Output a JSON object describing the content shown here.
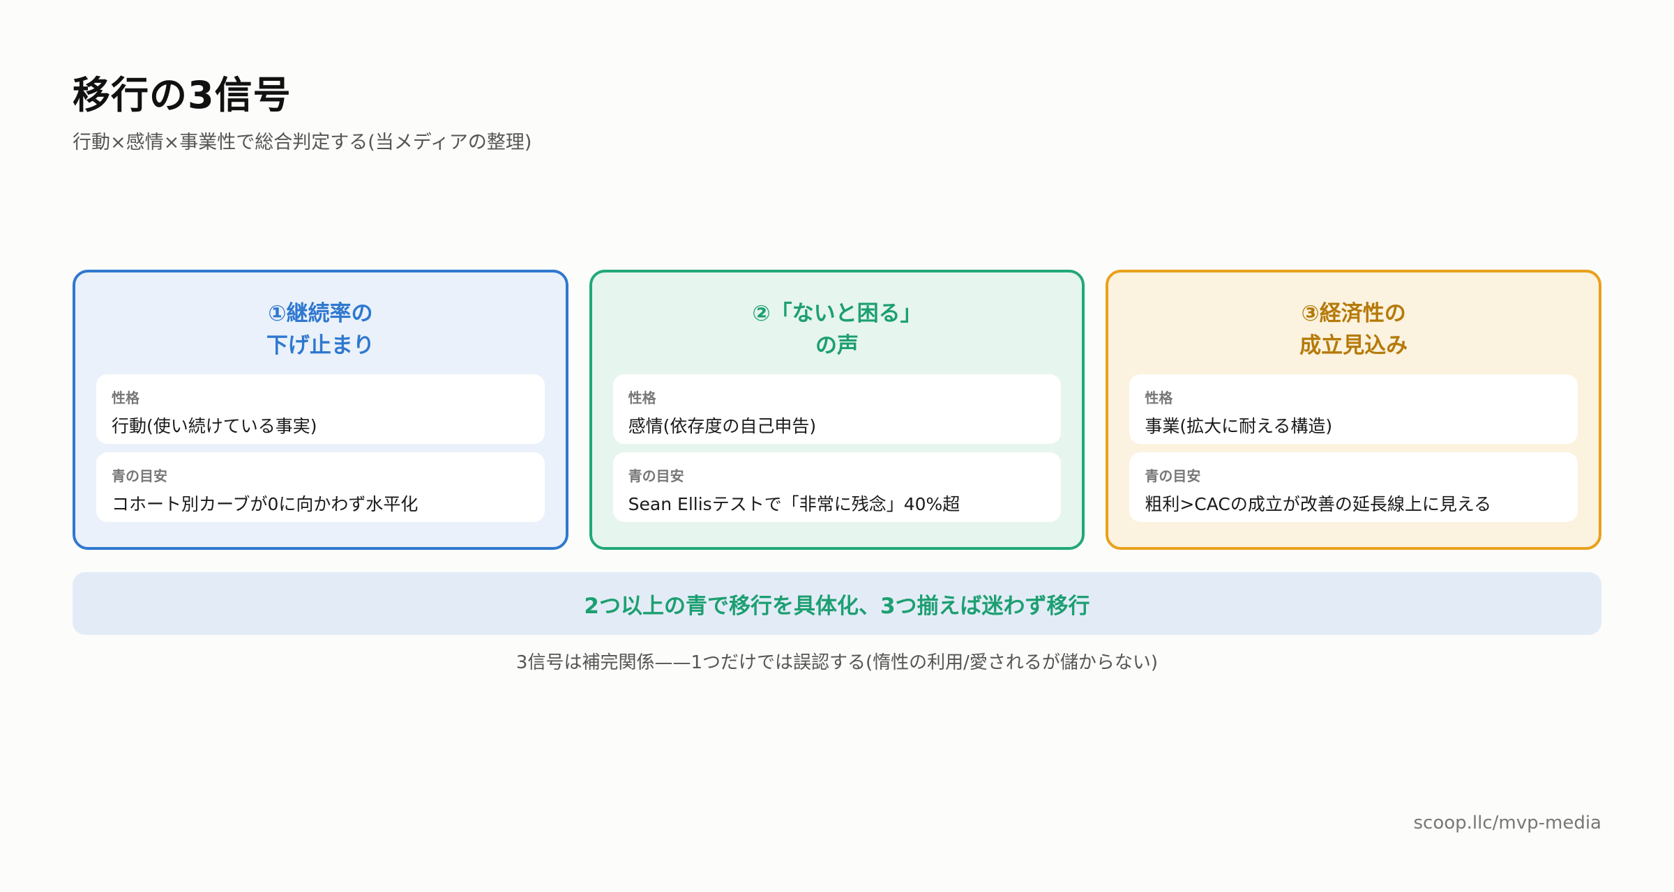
{
  "header": {
    "title": "移行の3信号",
    "subtitle": "行動×感情×事業性で総合判定する(当メディアの整理)"
  },
  "cards": [
    {
      "title_line1": "①継続率の",
      "title_line2": "下げ止まり",
      "nature_label": "性格",
      "nature_value": "行動(使い続けている事実)",
      "target_label": "青の目安",
      "target_value": "コホート別カーブが0に向かわず水平化",
      "accent": "#2f78cf"
    },
    {
      "title_line1": "②「ないと困る」",
      "title_line2": "の声",
      "nature_label": "性格",
      "nature_value": "感情(依存度の自己申告)",
      "target_label": "青の目安",
      "target_value": "Sean Ellisテストで「非常に残念」40%超",
      "accent": "#22a87a"
    },
    {
      "title_line1": "③経済性の",
      "title_line2": "成立見込み",
      "nature_label": "性格",
      "nature_value": "事業(拡大に耐える構造)",
      "target_label": "青の目安",
      "target_value": "粗利>CACの成立が改善の延長線上に見える",
      "accent": "#e8a11c"
    }
  ],
  "banner": {
    "text": "2つ以上の青で移行を具体化、3つ揃えば迷わず移行"
  },
  "note": {
    "text": "3信号は補完関係——1つだけでは誤認する(惰性の利用/愛されるが儲からない)"
  },
  "footer": {
    "url": "scoop.llc/mvp-media"
  }
}
